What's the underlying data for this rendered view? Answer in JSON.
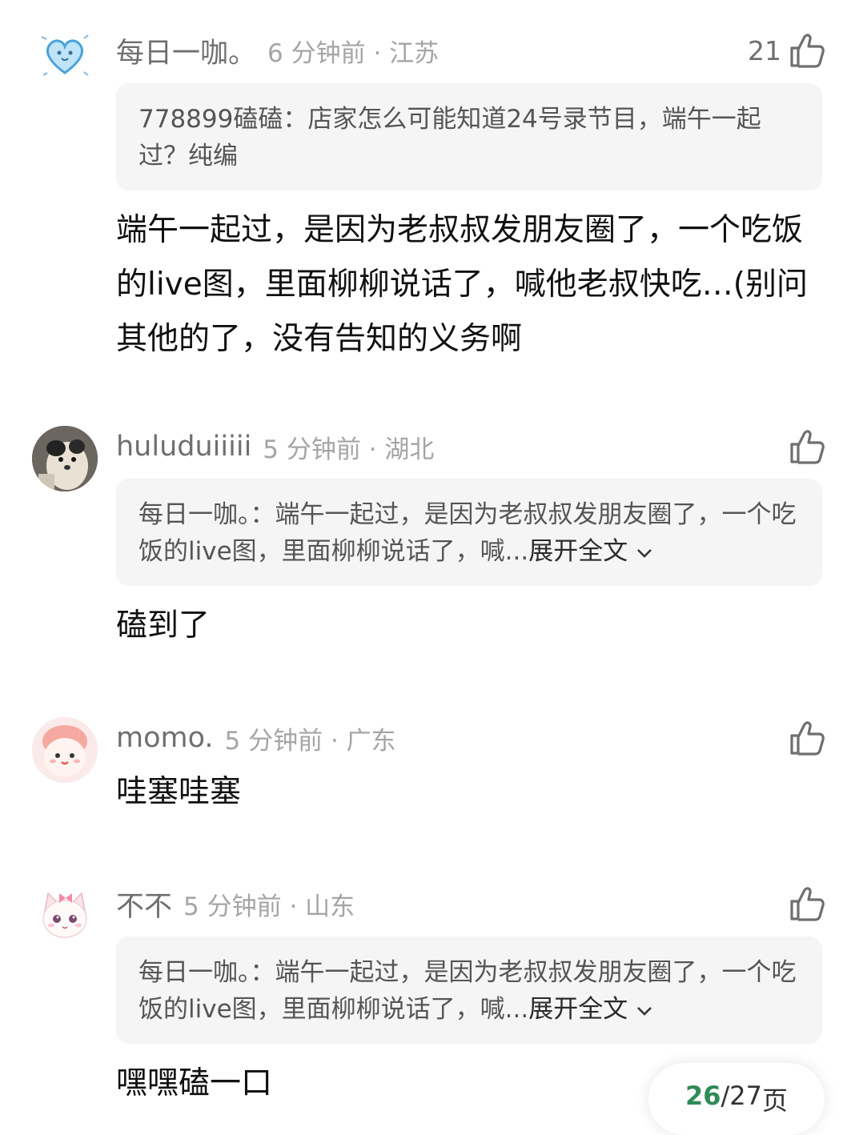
{
  "comments": [
    {
      "username": "每日一咖。",
      "time_location": "6 分钟前 · 江苏",
      "likes": "21",
      "quote": "778899磕磕：店家怎么可能知道24号录节目，端午一起过？纯编",
      "text": "端午一起过，是因为老叔叔发朋友圈了，一个吃饭的live图，里面柳柳说话了，喊他老叔快吃…(别问其他的了，没有告知的义务啊"
    },
    {
      "username": "huluduiiiii",
      "time_location": "5 分钟前 · 湖北",
      "quote": "每日一咖。：端午一起过，是因为老叔叔发朋友圈了，一个吃饭的live图，里面柳柳说话了，喊...",
      "expand": "展开全文",
      "text": "磕到了"
    },
    {
      "username": "momo.",
      "time_location": "5 分钟前 · 广东",
      "text": "哇塞哇塞"
    },
    {
      "username": "不不",
      "time_location": "5 分钟前 · 山东",
      "quote": "每日一咖。：端午一起过，是因为老叔叔发朋友圈了，一个吃饭的live图，里面柳柳说话了，喊...",
      "expand": "展开全文",
      "text": "嘿嘿磕一口"
    }
  ],
  "pager": {
    "current": "26",
    "total": "/27",
    "unit": "页"
  },
  "colors": {
    "accent": "#2e8b57",
    "quote_bg": "#f5f5f5",
    "meta_text": "#a5a5a5"
  }
}
